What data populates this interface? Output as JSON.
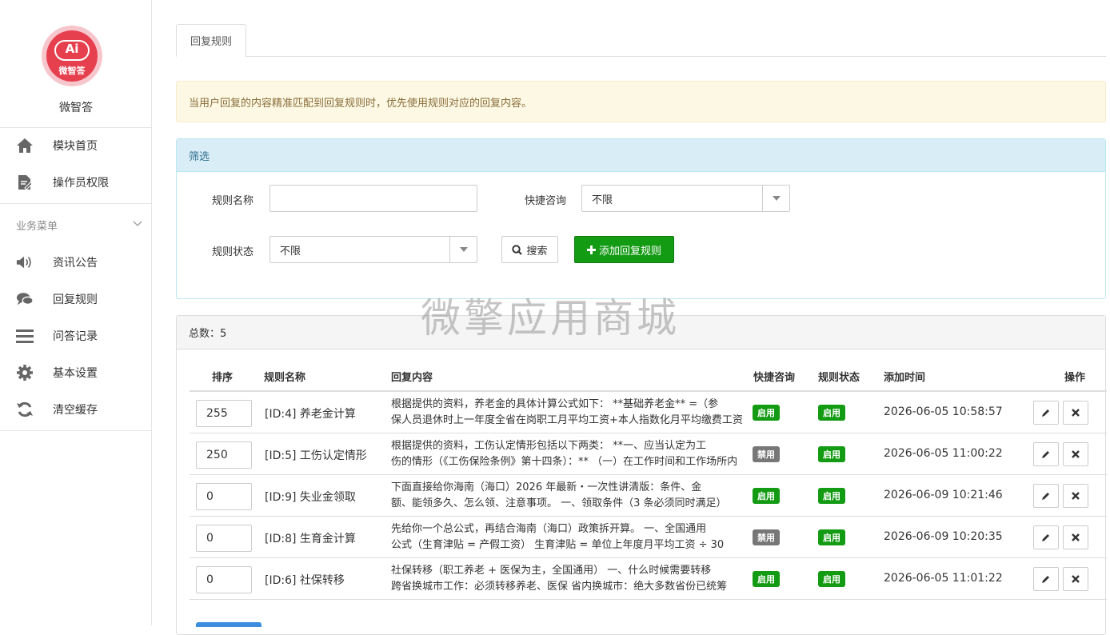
{
  "app": {
    "logo_text": "微智答",
    "logo_mark": "Ai",
    "name": "微智答"
  },
  "nav": {
    "top_items": [
      {
        "label": "模块首页",
        "icon": "home-icon"
      },
      {
        "label": "操作员权限",
        "icon": "file-edit-icon"
      }
    ],
    "section_title": "业务菜单",
    "section_items": [
      {
        "label": "资讯公告",
        "icon": "volume-icon"
      },
      {
        "label": "回复规则",
        "icon": "comments-icon"
      },
      {
        "label": "问答记录",
        "icon": "list-icon"
      },
      {
        "label": "基本设置",
        "icon": "gear-icon"
      },
      {
        "label": "清空缓存",
        "icon": "refresh-icon"
      }
    ]
  },
  "tab": {
    "label": "回复规则"
  },
  "alert": {
    "text": "当用户回复的内容精准匹配到回复规则时，优先使用规则对应的回复内容。"
  },
  "filter": {
    "title": "筛选",
    "name_label": "规则名称",
    "name_value": "",
    "quick_label": "快捷咨询",
    "quick_value": "不限",
    "status_label": "规则状态",
    "status_value": "不限",
    "search_label": "搜索",
    "add_label": "添加回复规则"
  },
  "list": {
    "total_label": "总数：5",
    "columns": [
      "排序",
      "规则名称",
      "回复内容",
      "快捷咨询",
      "规则状态",
      "添加时间",
      "操作"
    ],
    "rows": [
      {
        "sort": "255",
        "name": "[ID:4] 养老金计算",
        "content1": "根据提供的资料，养老金的具体计算公式如下： **基础养老金** =（参",
        "content2": "保人员退休时上一年度全省在岗职工月平均工资+本人指数化月平均缴费工资",
        "quick": "启用",
        "quick_color": "#149b14",
        "status": "启用",
        "status_color": "#149b14",
        "time": "2026-06-05 10:58:57"
      },
      {
        "sort": "250",
        "name": "[ID:5] 工伤认定情形",
        "content1": "根据提供的资料，工伤认定情形包括以下两类： **一、应当认定为工",
        "content2": "伤的情形（《工伤保险条例》第十四条）：** （一）在工作时间和工作场所内",
        "quick": "禁用",
        "quick_color": "#777777",
        "status": "启用",
        "status_color": "#149b14",
        "time": "2026-06-05 11:00:22"
      },
      {
        "sort": "0",
        "name": "[ID:9] 失业金领取",
        "content1": "下面直接给你海南（海口）2026 年最新・一次性讲清版：条件、金",
        "content2": "额、能领多久、怎么领、注意事项。 一、领取条件（3 条必须同时满足）",
        "quick": "启用",
        "quick_color": "#149b14",
        "status": "启用",
        "status_color": "#149b14",
        "time": "2026-06-09 10:21:46"
      },
      {
        "sort": "0",
        "name": "[ID:8] 生育金计算",
        "content1": "先给你一个总公式，再结合海南（海口）政策拆开算。 一、全国通用",
        "content2": "公式（生育津贴 = 产假工资） 生育津贴 = 单位上年度月平均工资 ÷ 30",
        "quick": "禁用",
        "quick_color": "#777777",
        "status": "启用",
        "status_color": "#149b14",
        "time": "2026-06-09 10:20:35"
      },
      {
        "sort": "0",
        "name": "[ID:6] 社保转移",
        "content1": "社保转移（职工养老 + 医保为主，全国通用） 一、什么时候需要转移",
        "content2": "跨省换城市工作：必须转移养老、医保 省内换城市：绝大多数省份已统筹",
        "quick": "启用",
        "quick_color": "#149b14",
        "status": "启用",
        "status_color": "#149b14",
        "time": "2026-06-05 11:01:22"
      }
    ]
  },
  "watermark": "微擎应用商城",
  "colors": {
    "green": "#149b14",
    "gray": "#777777",
    "brand": "#e6404f"
  }
}
